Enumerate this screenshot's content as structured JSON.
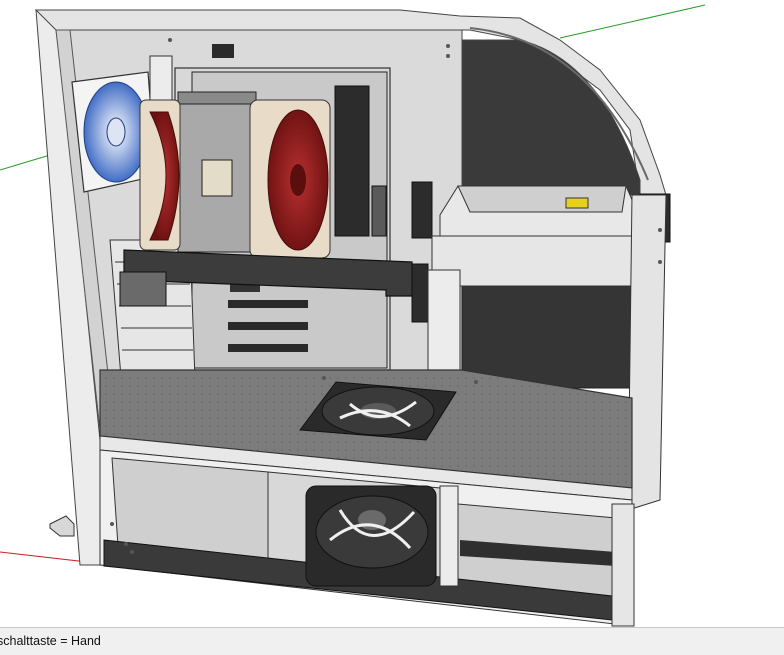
{
  "app": {
    "status_text": "schalttaste = Hand"
  },
  "icons": {
    "cursor": "hand-cursor-icon"
  },
  "colors": {
    "axis_red": "#cc2222",
    "axis_green": "#2a9a2a",
    "case_outer": "#e2e2e2",
    "case_interior": "#dadada",
    "case_floor": "#7c7c7c",
    "dark_panel": "#3a3a3a",
    "fan_blue": "#2f5fc0",
    "fan_dark_red": "#7a1414",
    "fan_beige": "#e8dcc8"
  }
}
